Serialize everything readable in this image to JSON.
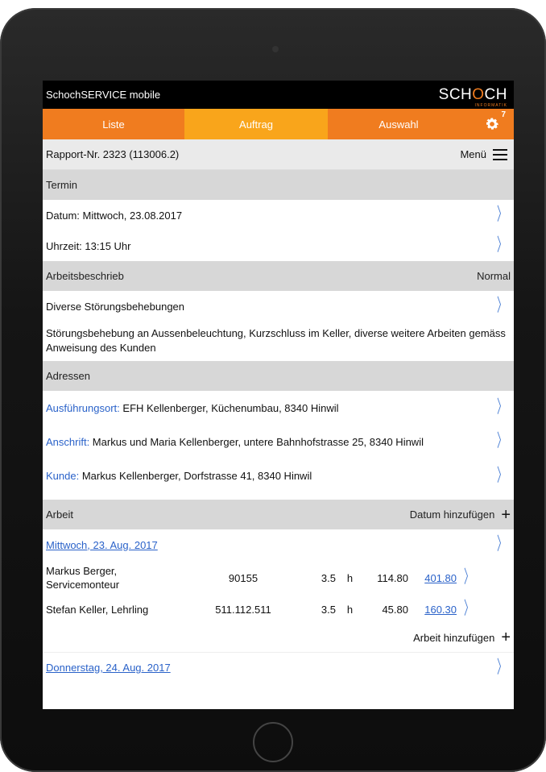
{
  "app": {
    "title": "SchochSERVICE mobile",
    "logo_text": "SCHOCH",
    "logo_sub": "INFORMATIK"
  },
  "tabs": [
    {
      "label": "Liste"
    },
    {
      "label": "Auftrag"
    },
    {
      "label": "Auswahl"
    }
  ],
  "settings": {
    "badge": "7"
  },
  "rapport": {
    "label": "Rapport-Nr. 2323  (113006.2)",
    "menu_label": "Menü"
  },
  "termin": {
    "title": "Termin",
    "datum": "Datum: Mittwoch, 23.08.2017",
    "uhrzeit": "Uhrzeit: 13:15 Uhr"
  },
  "arbeitsbeschrieb": {
    "title": "Arbeitsbeschrieb",
    "priority": "Normal",
    "summary": "Diverse Störungsbehebungen",
    "details": "Störungsbehebung an Aussenbeleuchtung, Kurzschluss im Keller, diverse weitere Arbeiten gemäss Anweisung des Kunden"
  },
  "adressen": {
    "title": "Adressen",
    "items": [
      {
        "label": "Ausführungsort:",
        "value": " EFH Kellenberger, Küchenumbau, 8340 Hinwil"
      },
      {
        "label": "Anschrift:",
        "value": " Markus und Maria Kellenberger, untere Bahnhofstrasse 25, 8340 Hinwil"
      },
      {
        "label": "Kunde:",
        "value": " Markus Kellenberger, Dorfstrasse 41, 8340 Hinwil"
      }
    ]
  },
  "arbeit": {
    "title": "Arbeit",
    "add_date": "Datum hinzufügen",
    "add_work": "Arbeit hinzufügen",
    "days": [
      {
        "date": "Mittwoch, 23. Aug. 2017"
      },
      {
        "date": "Donnerstag, 24. Aug. 2017"
      }
    ],
    "entries": [
      {
        "name": "Markus Berger,",
        "name2": "Servicemonteur",
        "code": "90155",
        "hours": "3.5",
        "unit": "h",
        "rate": "114.80",
        "total": "401.80"
      },
      {
        "name": "Stefan Keller, Lehrling",
        "name2": "",
        "code": "511.112.511",
        "hours": "3.5",
        "unit": "h",
        "rate": "45.80",
        "total": "160.30"
      }
    ]
  },
  "colors": {
    "orange": "#f07c1f",
    "active_tab": "#f9a51b",
    "link": "#2a62c9"
  },
  "icons": [
    "gear-icon",
    "hamburger-icon",
    "chevron-right-icon",
    "plus-icon"
  ]
}
